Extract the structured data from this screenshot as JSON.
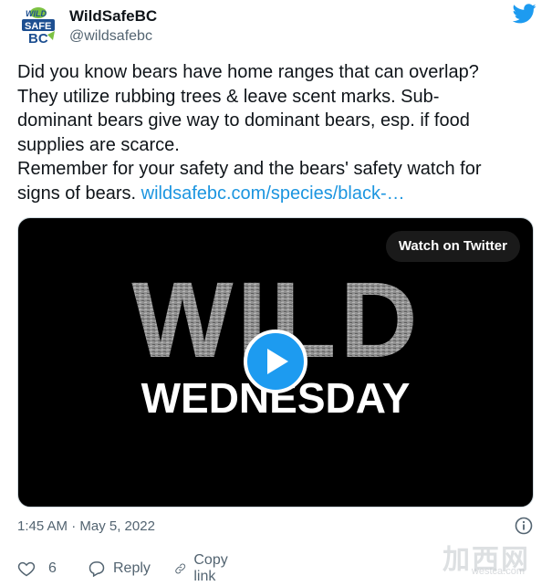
{
  "tweet": {
    "author": {
      "display_name": "WildSafeBC",
      "handle": "@wildsafebc",
      "avatar_logo_text": [
        "WILD",
        "SAFE",
        "BC"
      ]
    },
    "text_lines": [
      "Did you know bears have home ranges that can overlap?",
      "They utilize rubbing trees & leave scent marks. Sub-",
      "dominant bears give way to dominant bears, esp. if food",
      "supplies are scarce.",
      "Remember for your safety and the bears' safety watch for",
      "signs of bears. "
    ],
    "link_text": "wildsafebc.com/species/black-…",
    "media": {
      "watch_label": "Watch on Twitter",
      "overlay_title": "WILD",
      "overlay_subtitle": "WEDNESDAY"
    },
    "timestamp": "1:45 AM · May 5, 2022",
    "actions": {
      "like_count": "6",
      "reply_label": "Reply",
      "copy_label": "Copy link"
    }
  },
  "watermark": {
    "text": "加西网",
    "sub": "westca.com"
  },
  "colors": {
    "brand_blue": "#1d9bf0",
    "link_blue": "#1b95e0",
    "text_primary": "#0f1419",
    "text_secondary": "#536471"
  }
}
